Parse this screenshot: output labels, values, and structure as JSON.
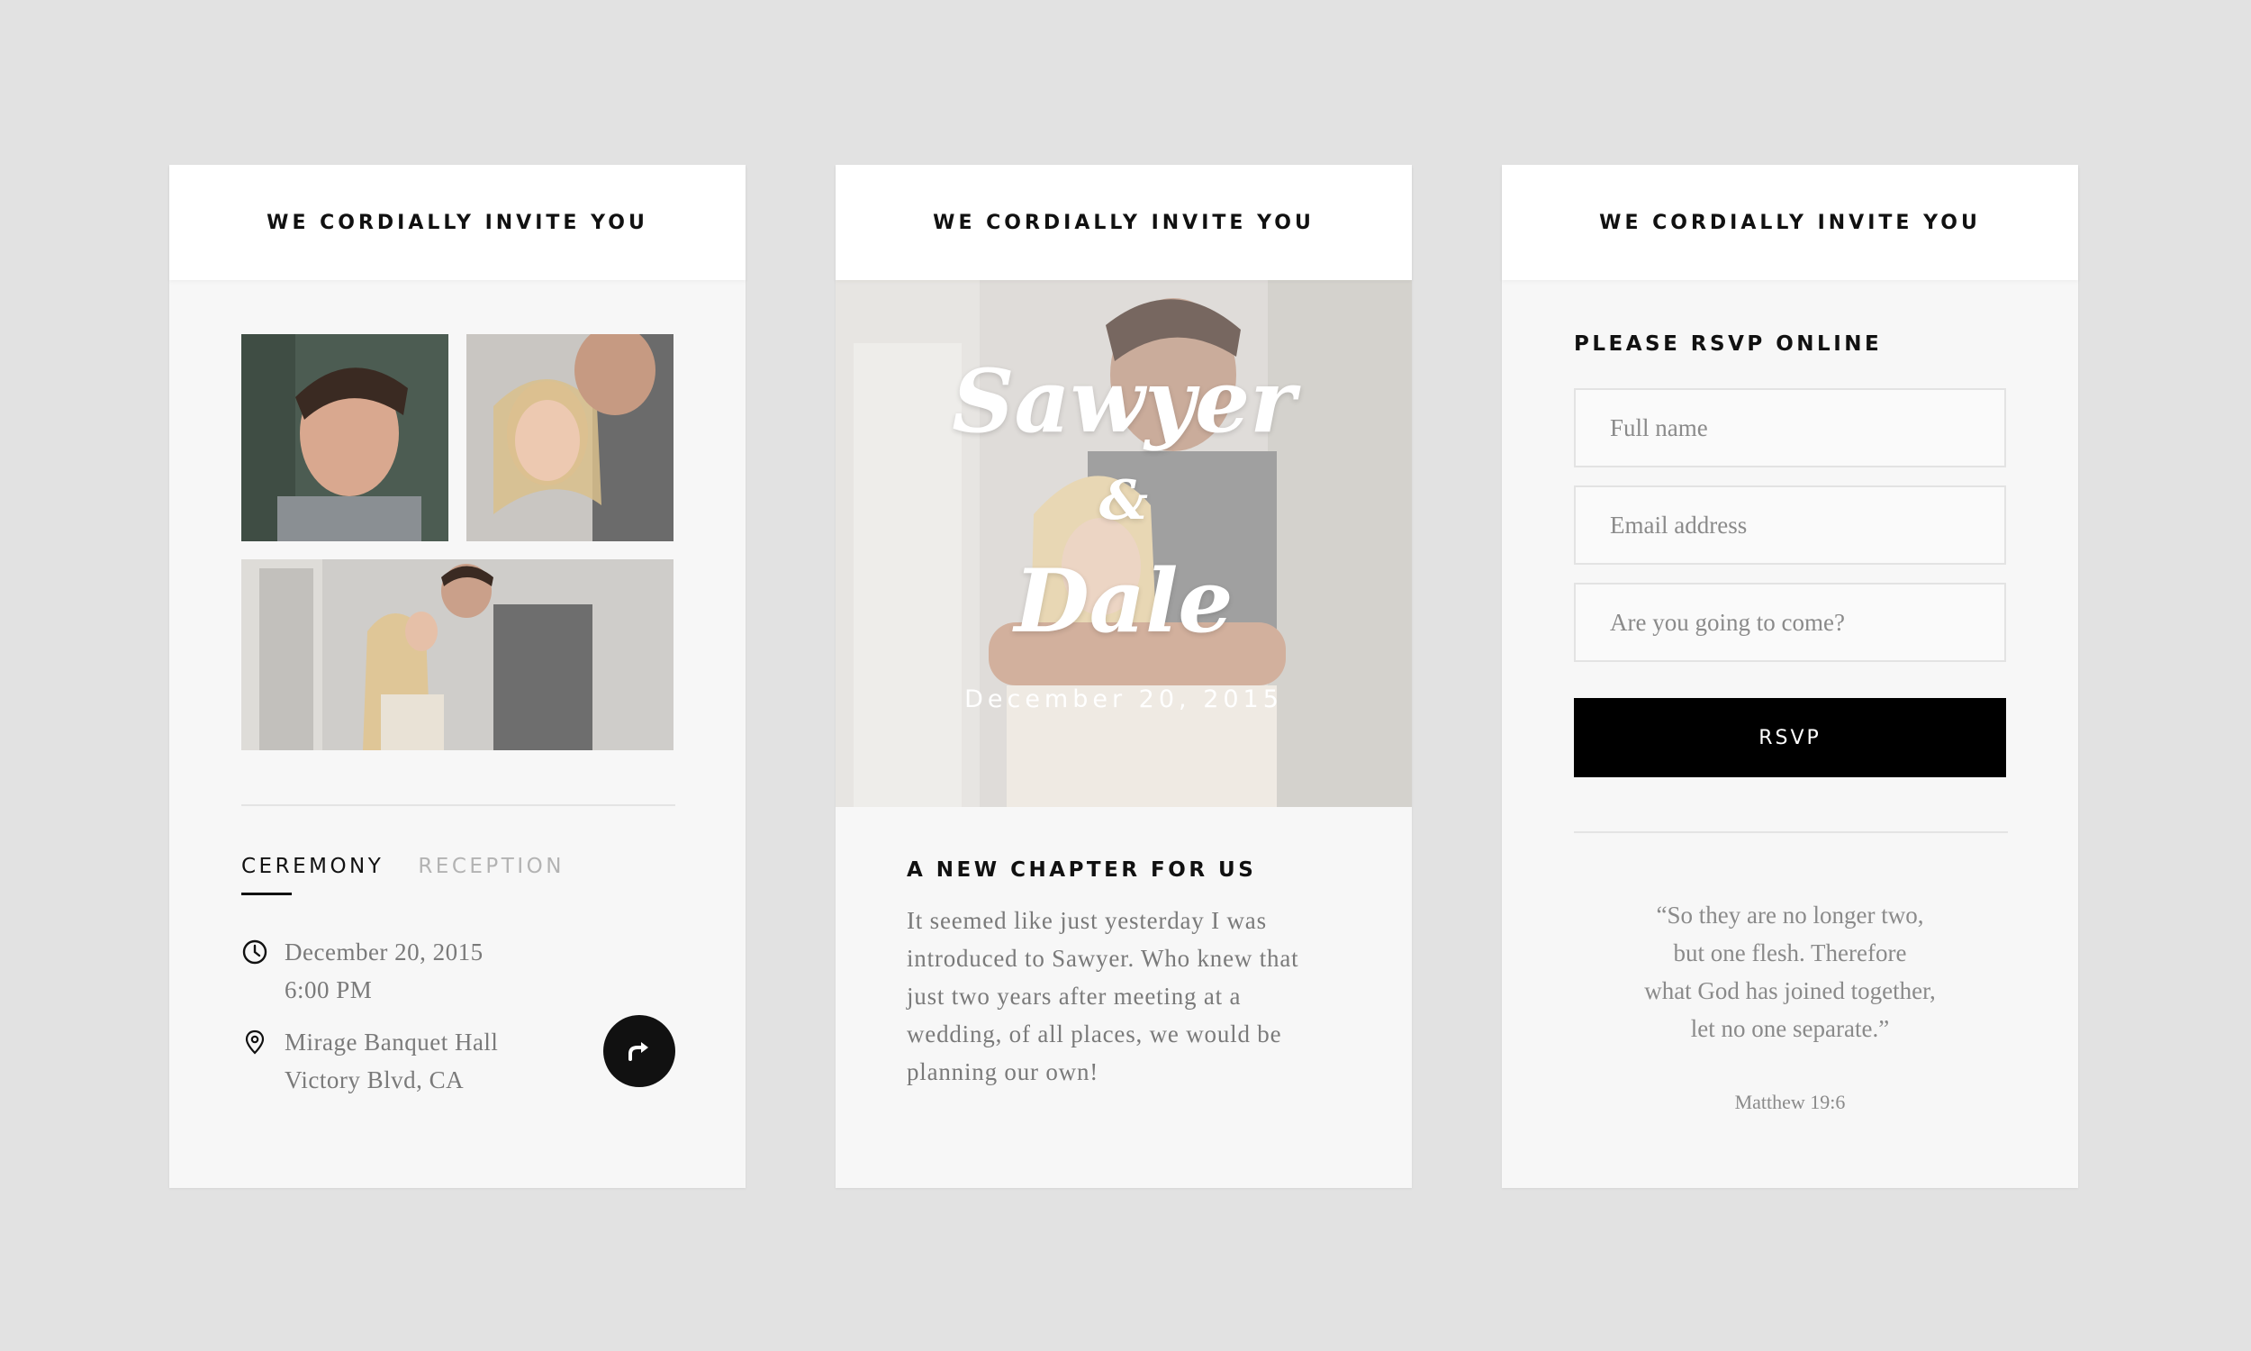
{
  "cards": [
    {
      "header": "WE CORDIALLY INVITE YOU",
      "tabs": [
        {
          "label": "CEREMONY",
          "active": true
        },
        {
          "label": "RECEPTION",
          "active": false
        }
      ],
      "date_line_1": "December 20, 2015",
      "date_line_2": "6:00 PM",
      "venue_line_1": "Mirage Banquet Hall",
      "venue_line_2": "Victory Blvd, CA",
      "share_icon": "share-arrow-icon"
    },
    {
      "header": "WE CORDIALLY INVITE YOU",
      "hero": {
        "name_1": "Sawyer",
        "ampersand": "&",
        "name_2": "Dale",
        "date": "December 20, 2015"
      },
      "section_title": "A NEW CHAPTER FOR US",
      "body_line_1": "It seemed like just yesterday I was",
      "body_line_2": "introduced to Sawyer. Who knew that",
      "body_line_3": "just two years after meeting at a",
      "body_line_4": "wedding, of all places, we would be",
      "body_line_5": "planning our own!"
    },
    {
      "header": "WE CORDIALLY INVITE YOU",
      "section_title": "PLEASE RSVP ONLINE",
      "fields": {
        "full_name_placeholder": "Full name",
        "email_placeholder": "Email address",
        "attend_placeholder": "Are you going to come?"
      },
      "button_label": "RSVP",
      "quote_line_1": "“So they are no longer two,",
      "quote_line_2": "but one flesh. Therefore",
      "quote_line_3": "what God has joined together,",
      "quote_line_4": "let no one separate.”",
      "quote_ref": "Matthew 19:6"
    }
  ],
  "colors": {
    "background": "#e2e2e2",
    "card": "#f7f7f7",
    "accent": "#000000",
    "muted_text": "#7a7a7a"
  }
}
